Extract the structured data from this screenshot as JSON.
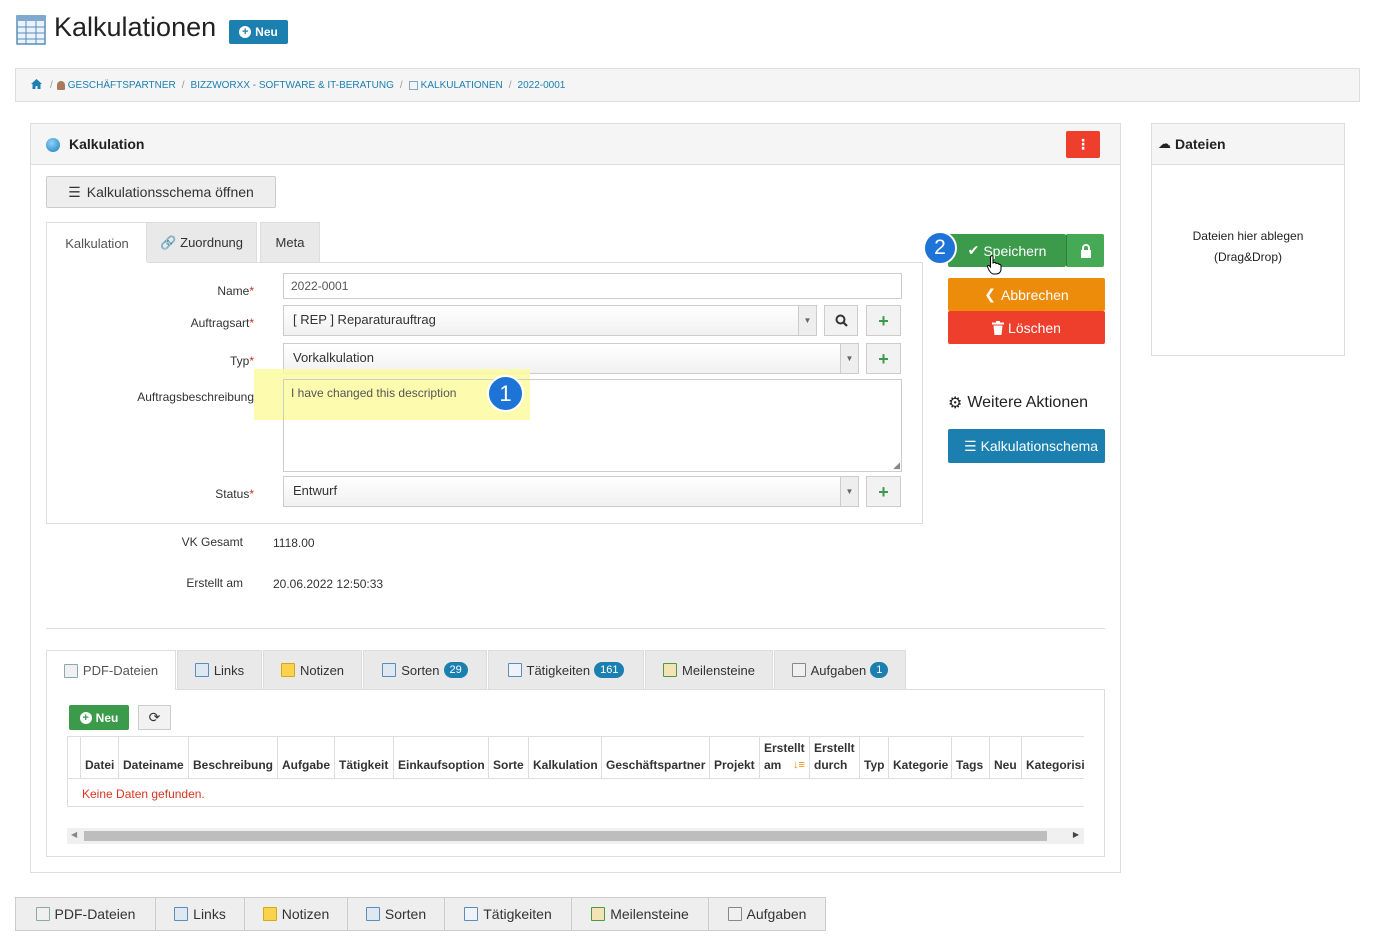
{
  "header": {
    "title": "Kalkulationen",
    "new_label": "Neu"
  },
  "breadcrumb": {
    "items": [
      "GESCHÄFTSPARTNER",
      "BIZZWORXX - SOFTWARE & IT-BERATUNG",
      "KALKULATIONEN",
      "2022-0001"
    ]
  },
  "panel": {
    "title": "Kalkulation",
    "open_schema_label": "Kalkulationsschema öffnen",
    "tabs": [
      "Kalkulation",
      "Zuordnung",
      "Meta"
    ]
  },
  "form": {
    "name_label": "Name",
    "name_value": "2022-0001",
    "auftragsart_label": "Auftragsart",
    "auftragsart_value": "[ REP ] Reparaturauftrag",
    "typ_label": "Typ",
    "typ_value": "Vorkalkulation",
    "beschreibung_label": "Auftragsbeschreibung",
    "beschreibung_value": "I have changed this description",
    "status_label": "Status",
    "status_value": "Entwurf",
    "vk_label": "VK Gesamt",
    "vk_value": "1118.00",
    "erstellt_label": "Erstellt am",
    "erstellt_value": "20.06.2022 12:50:33"
  },
  "actions": {
    "save": "Speichern",
    "cancel": "Abbrechen",
    "delete": "Löschen",
    "more": "Weitere Aktionen",
    "schema": "Kalkulationschema"
  },
  "annotations": {
    "step1": "1",
    "step2": "2"
  },
  "files_panel": {
    "title": "Dateien",
    "drop_line1": "Dateien hier ablegen",
    "drop_line2": "(Drag&Drop)"
  },
  "lower_tabs": [
    {
      "label": "PDF-Dateien",
      "badge": ""
    },
    {
      "label": "Links",
      "badge": ""
    },
    {
      "label": "Notizen",
      "badge": ""
    },
    {
      "label": "Sorten",
      "badge": "29"
    },
    {
      "label": "Tätigkeiten",
      "badge": "161"
    },
    {
      "label": "Meilensteine",
      "badge": ""
    },
    {
      "label": "Aufgaben",
      "badge": "1"
    }
  ],
  "table": {
    "new_label": "Neu",
    "columns": [
      "Datei",
      "Dateiname",
      "Beschreibung",
      "Aufgabe",
      "Tätigkeit",
      "Einkaufsoption",
      "Sorte",
      "Kalkulation",
      "Geschäftspartner",
      "Projekt",
      "Erstellt am",
      "Erstellt durch",
      "Typ",
      "Kategorie",
      "Tags",
      "Neu",
      "Kategorisi"
    ],
    "empty_text": "Keine Daten gefunden."
  },
  "bottom_tabs": [
    "PDF-Dateien",
    "Links",
    "Notizen",
    "Sorten",
    "Tätigkeiten",
    "Meilensteine",
    "Aufgaben"
  ],
  "colors": {
    "primary": "#1b7fb0",
    "success": "#3c9b4b",
    "warning": "#ec8c0a",
    "danger": "#ee3e2c",
    "highlight": "#fdfba0"
  }
}
